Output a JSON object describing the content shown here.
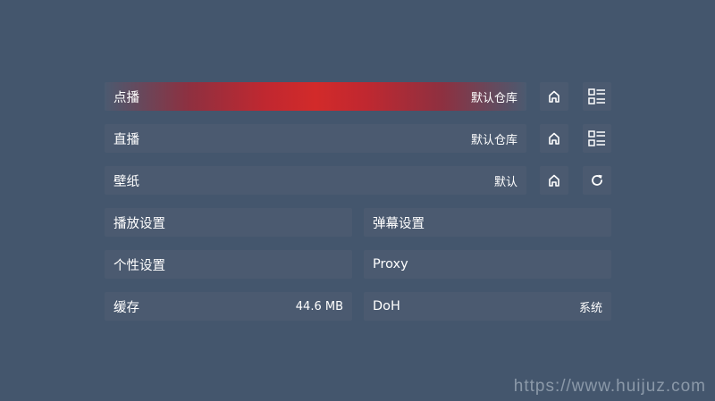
{
  "rows": {
    "vod": {
      "label": "点播",
      "value": "默认仓库"
    },
    "live": {
      "label": "直播",
      "value": "默认仓库"
    },
    "wallpaper": {
      "label": "壁纸",
      "value": "默认"
    },
    "player": {
      "label": "播放设置"
    },
    "danmaku": {
      "label": "弹幕设置"
    },
    "personal": {
      "label": "个性设置"
    },
    "proxy": {
      "label": "Proxy"
    },
    "cache": {
      "label": "缓存",
      "value": "44.6 MB"
    },
    "doh": {
      "label": "DoH",
      "value": "系统"
    }
  },
  "icons": {
    "vod_home": "home-icon",
    "vod_list": "list-icon",
    "live_home": "home-icon",
    "live_list": "list-icon",
    "wallpaper_home": "home-icon",
    "wallpaper_refresh": "refresh-icon"
  },
  "colors": {
    "background": "#44566d",
    "row": "#4b5a70",
    "focus_highlight": "#d22a2a"
  },
  "watermark": "https://www.huijuz.com"
}
